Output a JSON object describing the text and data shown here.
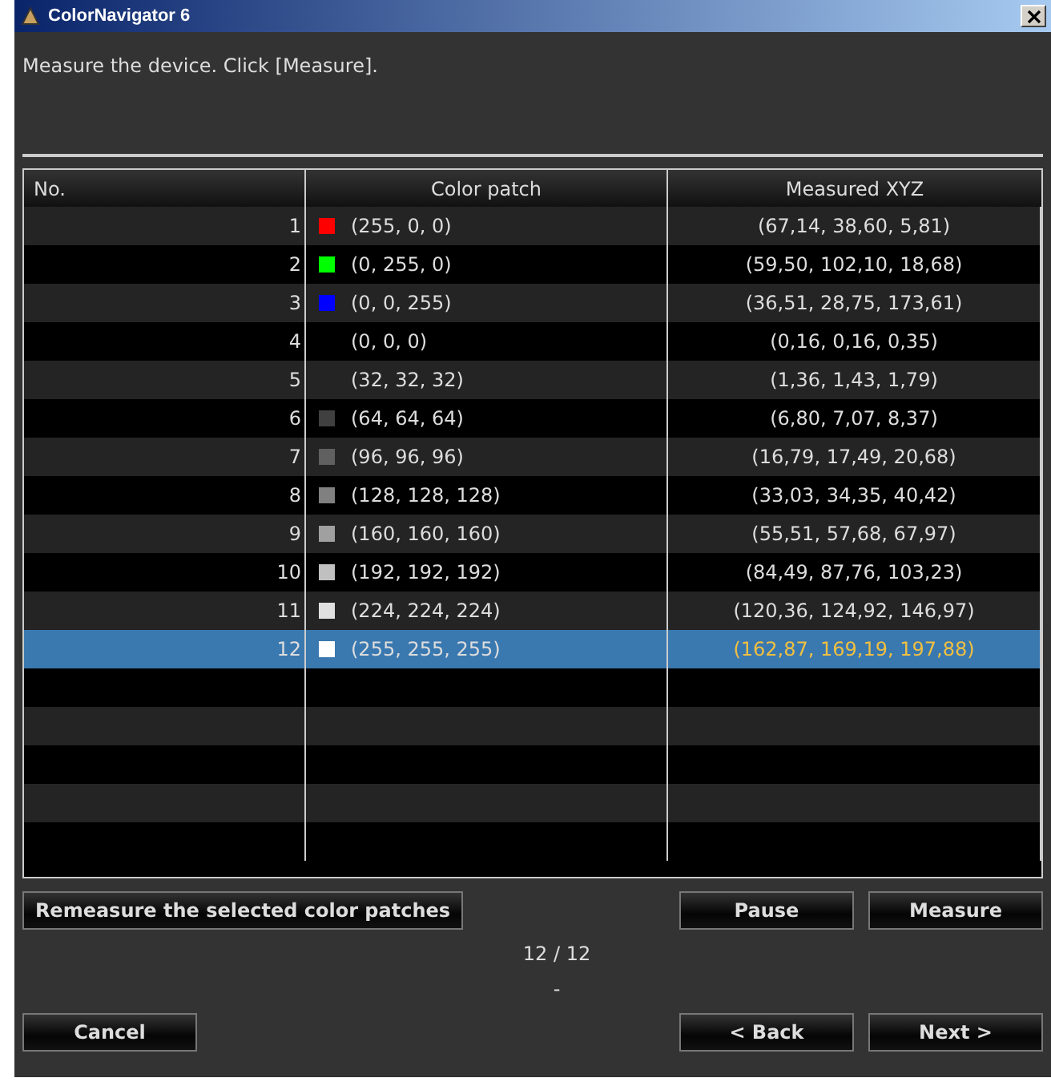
{
  "window": {
    "title": "ColorNavigator 6"
  },
  "message": "Measure the device. Click [Measure].",
  "table": {
    "columns": [
      "No.",
      "Color patch",
      "Measured XYZ"
    ],
    "rows": [
      {
        "no": "1",
        "color": "#ff0000",
        "patch": "(255, 0, 0)",
        "xyz": "(67,14, 38,60, 5,81)",
        "selected": false
      },
      {
        "no": "2",
        "color": "#00ff00",
        "patch": "(0, 255, 0)",
        "xyz": "(59,50, 102,10, 18,68)",
        "selected": false
      },
      {
        "no": "3",
        "color": "#0000ff",
        "patch": "(0, 0, 255)",
        "xyz": "(36,51, 28,75, 173,61)",
        "selected": false
      },
      {
        "no": "4",
        "color": "#000000",
        "patch": "(0, 0, 0)",
        "xyz": "(0,16, 0,16, 0,35)",
        "selected": false
      },
      {
        "no": "5",
        "color": "#202020",
        "patch": "(32, 32, 32)",
        "xyz": "(1,36, 1,43, 1,79)",
        "selected": false
      },
      {
        "no": "6",
        "color": "#404040",
        "patch": "(64, 64, 64)",
        "xyz": "(6,80, 7,07, 8,37)",
        "selected": false
      },
      {
        "no": "7",
        "color": "#606060",
        "patch": "(96, 96, 96)",
        "xyz": "(16,79, 17,49, 20,68)",
        "selected": false
      },
      {
        "no": "8",
        "color": "#808080",
        "patch": "(128, 128, 128)",
        "xyz": "(33,03, 34,35, 40,42)",
        "selected": false
      },
      {
        "no": "9",
        "color": "#a0a0a0",
        "patch": "(160, 160, 160)",
        "xyz": "(55,51, 57,68, 67,97)",
        "selected": false
      },
      {
        "no": "10",
        "color": "#c0c0c0",
        "patch": "(192, 192, 192)",
        "xyz": "(84,49, 87,76, 103,23)",
        "selected": false
      },
      {
        "no": "11",
        "color": "#e0e0e0",
        "patch": "(224, 224, 224)",
        "xyz": "(120,36, 124,92, 146,97)",
        "selected": false
      },
      {
        "no": "12",
        "color": "#ffffff",
        "patch": "(255, 255, 255)",
        "xyz": "(162,87, 169,19, 197,88)",
        "selected": true
      }
    ]
  },
  "remeasure_button": "Remeasure the selected color patches",
  "pause_button": "Pause",
  "measure_button": "Measure",
  "progress": "12 / 12",
  "status": "-",
  "cancel_button": "Cancel",
  "back_button": "< Back",
  "next_button": "Next >"
}
